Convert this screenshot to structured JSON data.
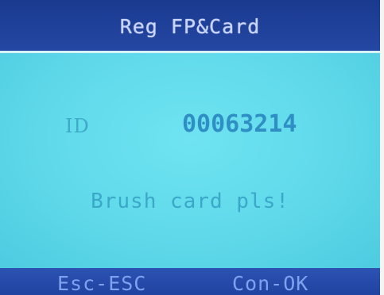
{
  "header": {
    "title": "Reg FP&Card"
  },
  "main": {
    "id_label": "ID",
    "id_value": "00063214",
    "prompt": "Brush card pls!"
  },
  "softkeys": {
    "left": "Esc-ESC",
    "right": "Con-OK"
  },
  "colors": {
    "header_bg": "#1e3f96",
    "content_bg": "#5fd9ea",
    "text_primary": "#2f8fc4"
  }
}
